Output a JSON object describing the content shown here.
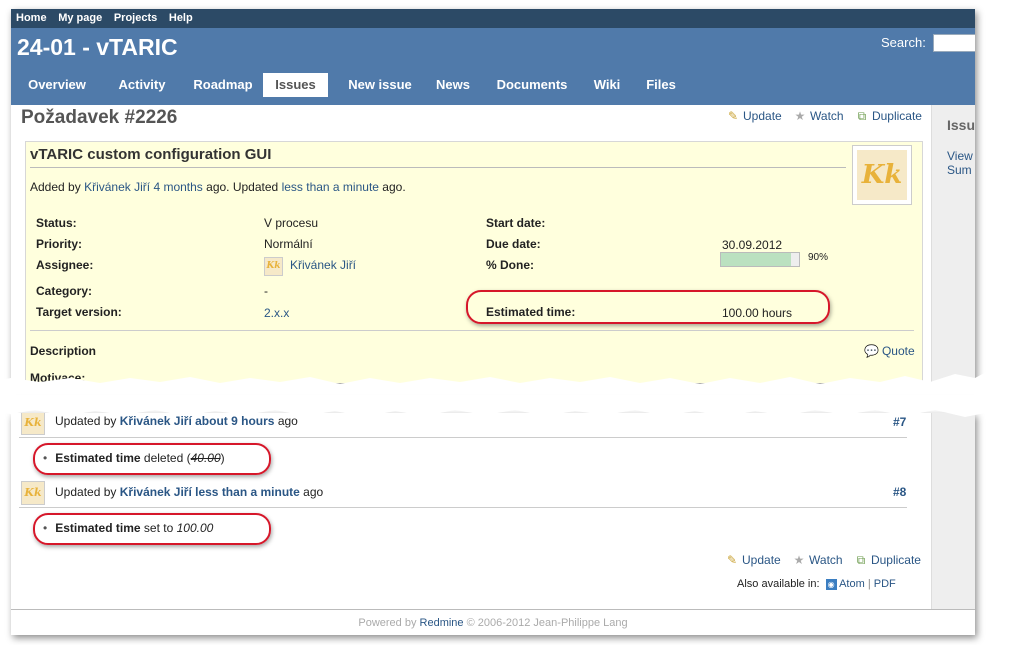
{
  "top_menu": [
    "Home",
    "My page",
    "Projects",
    "Help"
  ],
  "project_title": "24-01 - vTARIC",
  "search_label": "Search:",
  "tabs": [
    "Overview",
    "Activity",
    "Roadmap",
    "Issues",
    "New issue",
    "News",
    "Documents",
    "Wiki",
    "Files"
  ],
  "selected_tab": "Issues",
  "sidebar": {
    "heading": "Issue",
    "link1": "View",
    "link2": "Sum"
  },
  "issue_title": "Požadavek #2226",
  "contextual": {
    "update": "Update",
    "watch": "Watch",
    "duplicate": "Duplicate"
  },
  "subject": "vTARIC custom configuration GUI",
  "author_line": {
    "added_by": "Added by",
    "author": "Křivánek Jiří",
    "added_ago": "4 months",
    "ago": "ago.",
    "updated": "Updated",
    "updated_ago": "less than a minute",
    "ago2": "ago."
  },
  "avatar_letters": "Kk",
  "attributes": {
    "status_label": "Status:",
    "status_value": "V procesu",
    "priority_label": "Priority:",
    "priority_value": "Normální",
    "assignee_label": "Assignee:",
    "assignee_value": "Křivánek Jiří",
    "category_label": "Category:",
    "category_value": "-",
    "target_label": "Target version:",
    "target_value": "2.x.x",
    "start_label": "Start date:",
    "start_value": "",
    "due_label": "Due date:",
    "due_value": "30.09.2012",
    "done_label": "% Done:",
    "done_percent": 90,
    "done_text": "90%",
    "estimated_label": "Estimated time:",
    "estimated_value": "100.00 hours"
  },
  "description_label": "Description",
  "quote_label": "Quote",
  "motivace_label": "Motivace:",
  "journal_7": {
    "prefix": "Updated by",
    "author": "Křivánek Jiří",
    "ago": "about 9 hours",
    "suffix": "ago",
    "number": "#7"
  },
  "journal_7_detail": {
    "field": "Estimated time",
    "action": "deleted",
    "value": "40.00"
  },
  "journal_8": {
    "prefix": "Updated by",
    "author": "Křivánek Jiří",
    "ago": "less than a minute",
    "suffix": "ago",
    "number": "#8"
  },
  "journal_8_detail": {
    "field": "Estimated time",
    "action": "set to",
    "value": "100.00"
  },
  "also_available": {
    "label": "Also available in:",
    "atom": "Atom",
    "sep": "|",
    "pdf": "PDF"
  },
  "footer": {
    "powered_by": "Powered by",
    "redmine": "Redmine",
    "copyright": "© 2006-2012 Jean-Philippe Lang"
  },
  "colors": {
    "header": "#507aaa",
    "top_menu": "#2c4a66",
    "issue_bg": "#ffffdd",
    "link": "#2a5685",
    "highlight": "#d6172a",
    "progress": "#bbe1c0"
  }
}
